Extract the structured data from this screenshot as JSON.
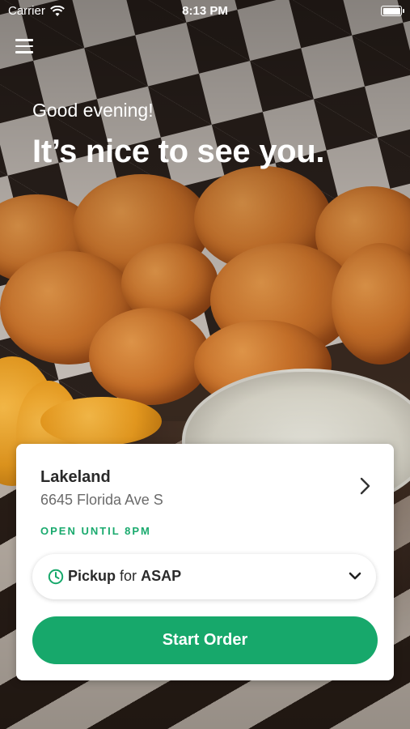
{
  "status_bar": {
    "carrier": "Carrier",
    "time": "8:13 PM"
  },
  "header": {
    "greeting": "Good evening!",
    "headline": "It’s nice to see you."
  },
  "location": {
    "name": "Lakeland",
    "address": "6645 Florida Ave S",
    "hours_status": "OPEN UNTIL 8PM"
  },
  "order_mode": {
    "mode": "Pickup",
    "connector": "for",
    "time": "ASAP"
  },
  "actions": {
    "start_order_label": "Start Order"
  },
  "colors": {
    "accent": "#17a86b",
    "status_green": "#1aaa6e"
  },
  "icons": [
    "menu-icon",
    "wifi-icon",
    "battery-icon",
    "chevron-right-icon",
    "clock-icon",
    "chevron-down-icon"
  ]
}
